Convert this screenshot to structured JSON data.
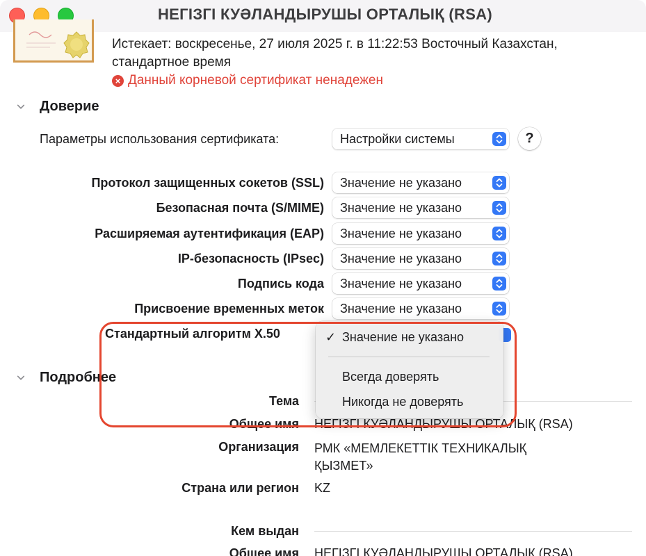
{
  "window": {
    "title": "НЕГІЗГІ КУӘЛАНДЫРУШЫ ОРТАЛЫҚ (RSA)"
  },
  "header": {
    "expires": "Истекает: воскресенье, 27 июля 2025 г. в 11:22:53 Восточный Казахстан, стандартное время",
    "warning": "Данный корневой сертификат ненадежен",
    "warning_icon": "x-circle-icon"
  },
  "trust": {
    "section_title": "Доверие",
    "usage_label": "Параметры использования сертификата:",
    "usage_value": "Настройки системы",
    "help_label": "?",
    "rows": [
      {
        "label": "Протокол защищенных сокетов (SSL)",
        "value": "Значение не указано"
      },
      {
        "label": "Безопасная почта (S/MIME)",
        "value": "Значение не указано"
      },
      {
        "label": "Расширяемая аутентификация (EAP)",
        "value": "Значение не указано"
      },
      {
        "label": "IP-безопасность (IPsec)",
        "value": "Значение не указано"
      },
      {
        "label": "Подпись кода",
        "value": "Значение не указано"
      },
      {
        "label": "Присвоение временных меток",
        "value": "Значение не указано"
      },
      {
        "label": "Стандартный алгоритм X.50",
        "value": ""
      }
    ]
  },
  "dropdown_menu": {
    "items": [
      {
        "label": "Значение не указано",
        "checked": true
      },
      {
        "label": "Всегда доверять",
        "checked": false
      },
      {
        "label": "Никогда не доверять",
        "checked": false
      }
    ],
    "check_glyph": "✓"
  },
  "details": {
    "section_title": "Подробнее",
    "subject_heading": "Тема",
    "subject": [
      {
        "label": "Общее имя",
        "value": "НЕГІЗГІ КУӘЛАНДЫРУШЫ ОРТАЛЫҚ (RSA)"
      },
      {
        "label": "Организация",
        "value": "РМК «МЕМЛЕКЕТТІК ТЕХНИКАЛЫҚ ҚЫЗМЕТ»"
      },
      {
        "label": "Страна или регион",
        "value": "KZ"
      }
    ],
    "issuer_heading": "Кем выдан",
    "issuer": [
      {
        "label": "Общее имя",
        "value": "НЕГІЗГІ КУӘЛАНДЫРУШЫ ОРТАЛЫҚ (RSA)"
      }
    ]
  },
  "colors": {
    "accent": "#3478f6",
    "warning": "#e0443a",
    "annotation": "#e4462f"
  }
}
